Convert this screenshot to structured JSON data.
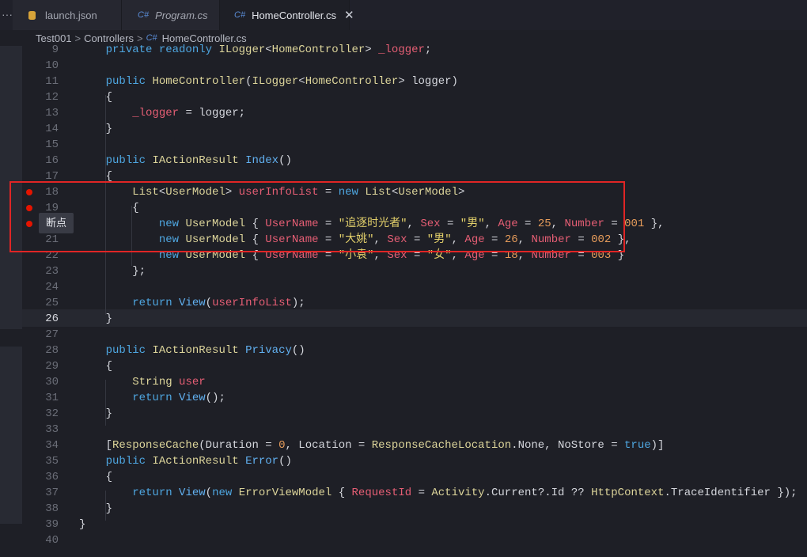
{
  "tabs": [
    {
      "label": "launch.json",
      "icon": "json-settings-icon",
      "active": false
    },
    {
      "label": "Program.cs",
      "icon": "csharp-icon",
      "active": false
    },
    {
      "label": "HomeController.cs",
      "icon": "csharp-icon",
      "active": true
    }
  ],
  "tab_icon_text": "C#",
  "overflow_glyph": "···",
  "close_glyph": "✕",
  "breadcrumb": {
    "project": "Test001",
    "folder": "Controllers",
    "sep": ">",
    "file_icon_text": "C#",
    "file": "HomeController.cs"
  },
  "editor": {
    "current_line": 26,
    "breakpoint_lines": [
      18,
      19,
      20
    ],
    "tooltip": "断点",
    "line_numbers": [
      "9",
      "10",
      "11",
      "12",
      "13",
      "14",
      "15",
      "16",
      "17",
      "18",
      "19",
      "20",
      "21",
      "22",
      "23",
      "24",
      "25",
      "26",
      "27",
      "28",
      "29",
      "30",
      "31",
      "32",
      "33",
      "34",
      "35",
      "36",
      "37",
      "38",
      "39",
      "40"
    ],
    "code_lines": [
      "    private readonly ILogger<HomeController> _logger;",
      "",
      "    public HomeController(ILogger<HomeController> logger)",
      "    {",
      "        _logger = logger;",
      "    }",
      "",
      "    public IActionResult Index()",
      "    {",
      "        List<UserModel> userInfoList = new List<UserModel>",
      "        {",
      "            new UserModel { UserName = \"追逐时光者\", Sex = \"男\", Age = 25, Number = 001 },",
      "            new UserModel { UserName = \"大姚\", Sex = \"男\", Age = 26, Number = 002 },",
      "            new UserModel { UserName = \"小袁\", Sex = \"女\", Age = 18, Number = 003 }",
      "        };",
      "",
      "        return View(userInfoList);",
      "    }",
      "",
      "    public IActionResult Privacy()",
      "    {",
      "        String user",
      "        return View();",
      "    }",
      "",
      "    [ResponseCache(Duration = 0, Location = ResponseCacheLocation.None, NoStore = true)]",
      "    public IActionResult Error()",
      "    {",
      "        return View(new ErrorViewModel { RequestId = Activity.Current?.Id ?? HttpContext.TraceIdentifier });",
      "    }",
      "}",
      ""
    ]
  },
  "colors": {
    "breakpoint": "#e51400",
    "highlight_box": "#e02525",
    "keyword": "#4ea6e0",
    "type": "#dcd49a",
    "string": "#e3d06b",
    "field": "#e55e74"
  }
}
